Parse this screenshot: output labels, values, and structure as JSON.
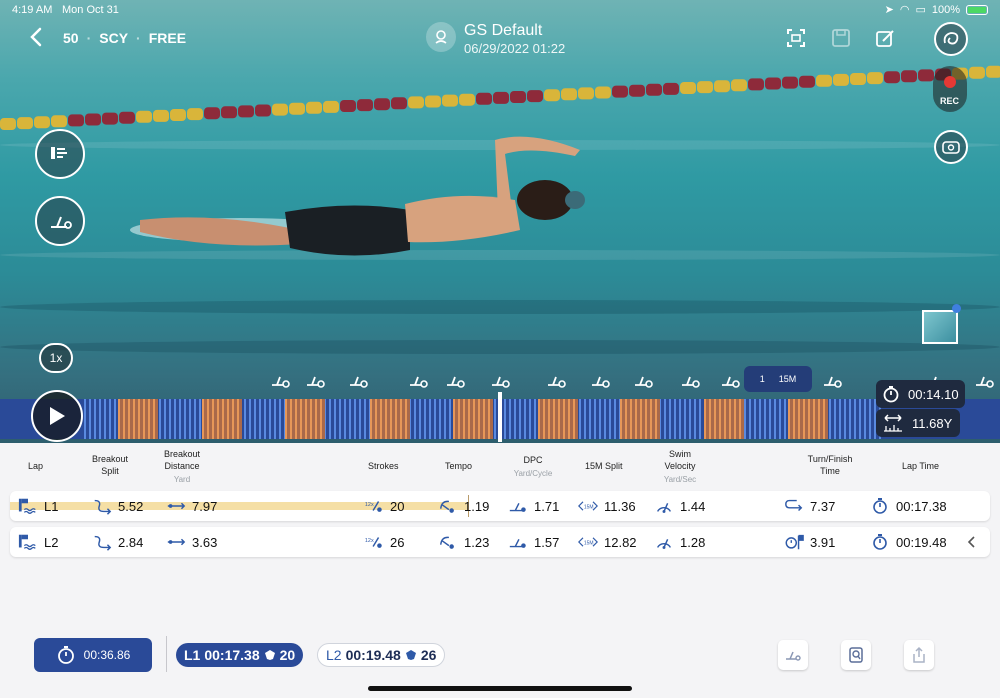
{
  "status_bar": {
    "time": "4:19 AM",
    "date": "Mon Oct 31",
    "battery": "100%"
  },
  "header": {
    "distance": "50",
    "course": "SCY",
    "stroke": "FREE",
    "title": "GS Default",
    "datetime": "06/29/2022 01:22"
  },
  "video": {
    "rec_label": "REC",
    "speed": "1x",
    "lap_marker_left": "1",
    "lap_marker_right": "15M",
    "elapsed_time": "00:14.10",
    "distance_readout": "11.68Y"
  },
  "table": {
    "headers": {
      "lap": "Lap",
      "breakout_split": "Breakout Split",
      "breakout_distance": "Breakout Distance",
      "breakout_distance_unit": "Yard",
      "strokes": "Strokes",
      "tempo": "Tempo",
      "dpc": "DPC",
      "dpc_unit": "Yard/Cycle",
      "split_15m": "15M Split",
      "swim_velocity": "Swim Velocity",
      "swim_velocity_unit": "Yard/Sec",
      "turn_finish": "Turn/Finish Time",
      "lap_time": "Lap Time"
    },
    "rows": [
      {
        "lap": "L1",
        "breakout_split": "5.52",
        "breakout_distance": "7.97",
        "strokes": "20",
        "tempo": "1.19",
        "dpc": "1.71",
        "split_15m": "11.36",
        "swim_velocity": "1.44",
        "turn_finish": "7.37",
        "lap_time": "00:17.38",
        "split_icon_text": "15M",
        "strokes_icon_text": "12x"
      },
      {
        "lap": "L2",
        "breakout_split": "2.84",
        "breakout_distance": "3.63",
        "strokes": "26",
        "tempo": "1.23",
        "dpc": "1.57",
        "split_15m": "12.82",
        "swim_velocity": "1.28",
        "turn_finish": "3.91",
        "lap_time": "00:19.48",
        "split_icon_text": "15M",
        "strokes_icon_text": "12x"
      }
    ]
  },
  "bottom": {
    "total_time": "00:36.86",
    "lap1_label": "L1",
    "lap1_time": "00:17.38",
    "lap1_strokes": "20",
    "lap2_label": "L2",
    "lap2_time": "00:19.48",
    "lap2_strokes": "26"
  },
  "colors": {
    "accent": "#2a4a98",
    "highlight": "#f5dfa5",
    "rec": "#e53935"
  }
}
